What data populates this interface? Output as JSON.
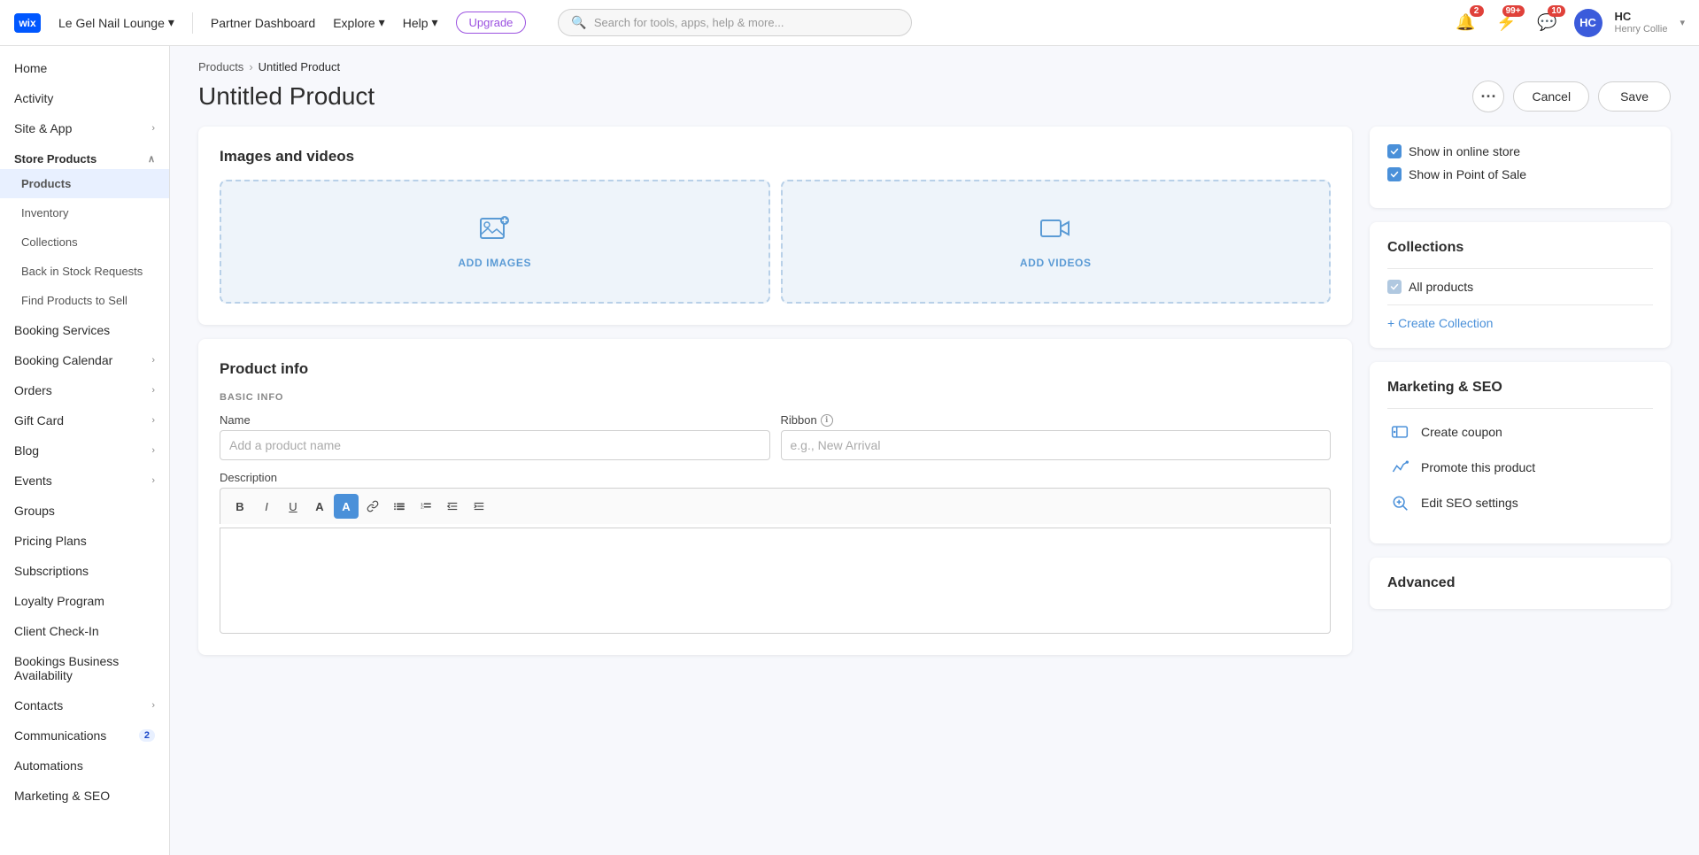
{
  "topNav": {
    "wixLogoText": "wix",
    "siteName": "Le Gel Nail Lounge",
    "partnerDashboard": "Partner Dashboard",
    "explore": "Explore",
    "help": "Help",
    "upgradeBtn": "Upgrade",
    "searchPlaceholder": "Search for tools, apps, help & more...",
    "notifications": {
      "bell": {
        "badge": "2"
      },
      "alert": {
        "badge": "99+"
      },
      "chat": {
        "badge": "10"
      }
    },
    "user": {
      "initials": "HC",
      "name": "HC",
      "subname": "Henry Collie"
    }
  },
  "sidebar": {
    "home": "Home",
    "activity": "Activity",
    "siteAndApp": "Site & App",
    "storeProducts": "Store Products",
    "products": "Products",
    "inventory": "Inventory",
    "collections": "Collections",
    "backInStock": "Back in Stock Requests",
    "findProducts": "Find Products to Sell",
    "bookingServices": "Booking Services",
    "bookingCalendar": "Booking Calendar",
    "orders": "Orders",
    "giftCard": "Gift Card",
    "blog": "Blog",
    "events": "Events",
    "groups": "Groups",
    "pricingPlans": "Pricing Plans",
    "subscriptions": "Subscriptions",
    "loyaltyProgram": "Loyalty Program",
    "clientCheckIn": "Client Check-In",
    "bookingsBusiness": "Bookings Business Availability",
    "contacts": "Contacts",
    "communications": "Communications",
    "communicationsBadge": "2",
    "automations": "Automations",
    "marketingSEO": "Marketing & SEO"
  },
  "breadcrumb": {
    "products": "Products",
    "current": "Untitled Product"
  },
  "pageHeader": {
    "title": "Untitled Product",
    "cancelBtn": "Cancel",
    "saveBtn": "Save"
  },
  "imagesVideos": {
    "title": "Images and videos",
    "addImages": "ADD IMAGES",
    "addVideos": "ADD VIDEOS"
  },
  "productInfo": {
    "title": "Product info",
    "sectionLabel": "BASIC INFO",
    "nameLabel": "Name",
    "namePlaceholder": "Add a product name",
    "ribbonLabel": "Ribbon",
    "ribbonPlaceholder": "e.g., New Arrival",
    "descriptionLabel": "Description",
    "toolbar": {
      "bold": "B",
      "italic": "I",
      "underline": "U",
      "textColor": "A",
      "highlight": "A",
      "link": "🔗",
      "bulletList": "≡",
      "numberedList": "≡",
      "indentLeft": "⇤",
      "indentRight": "⇥"
    }
  },
  "rightPanel": {
    "showInOnlineStore": "Show in online store",
    "showInPointOfSale": "Show in Point of Sale",
    "collectionsTitle": "Collections",
    "allProducts": "All products",
    "createCollection": "+ Create Collection",
    "marketingTitle": "Marketing & SEO",
    "createCoupon": "Create coupon",
    "promoteProduct": "Promote this product",
    "editSEO": "Edit SEO settings",
    "advancedTitle": "Advanced"
  }
}
